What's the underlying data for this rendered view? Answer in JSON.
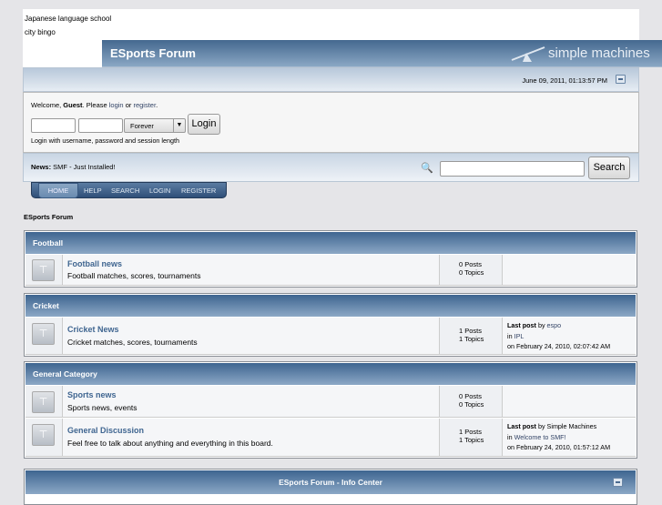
{
  "top_links": [
    "Japanese language school",
    "city bingo"
  ],
  "header": {
    "title": "ESports Forum",
    "logo_text": "simple machines",
    "date": "June 09, 2011, 01:13:57 PM"
  },
  "login": {
    "welcome_prefix": "Welcome, ",
    "guest": "Guest",
    "please": ". Please ",
    "login_link": "login",
    "or": " or ",
    "register_link": "register",
    "period": ".",
    "session_value": "Forever",
    "login_button": "Login",
    "hint": "Login with username, password and session length"
  },
  "news": {
    "label": "News:",
    "text": " SMF - Just Installed!",
    "search_button": "Search",
    "search_value": ""
  },
  "menu": [
    "HOME",
    "HELP",
    "SEARCH",
    "LOGIN",
    "REGISTER"
  ],
  "breadcrumb": "ESports Forum",
  "categories": [
    {
      "name": "Football",
      "boards": [
        {
          "name": "Football news",
          "desc": "Football matches, scores, tournaments",
          "posts": "0 Posts",
          "topics": "0 Topics"
        }
      ]
    },
    {
      "name": "Cricket",
      "boards": [
        {
          "name": "Cricket News",
          "desc": "Cricket matches, scores, tournaments",
          "posts": "1 Posts",
          "topics": "1 Topics",
          "lp_label": "Last post",
          "lp_by": " by ",
          "lp_user": "espo",
          "lp_in": "in ",
          "lp_topic": "IPL",
          "lp_date": "on February 24, 2010, 02:07:42 AM"
        }
      ]
    },
    {
      "name": "General Category",
      "boards": [
        {
          "name": "Sports news",
          "desc": "Sports news, events",
          "posts": "0 Posts",
          "topics": "0 Topics"
        },
        {
          "name": "General Discussion",
          "desc": "Feel free to talk about anything and everything in this board.",
          "posts": "1 Posts",
          "topics": "1 Topics",
          "lp_label": "Last post",
          "lp_by": " by ",
          "lp_user": "Simple Machines",
          "lp_in": "in ",
          "lp_topic": "Welcome to SMF!",
          "lp_date": "on February 24, 2010, 01:57:12 AM"
        }
      ]
    }
  ],
  "info_center": "ESports Forum - Info Center"
}
